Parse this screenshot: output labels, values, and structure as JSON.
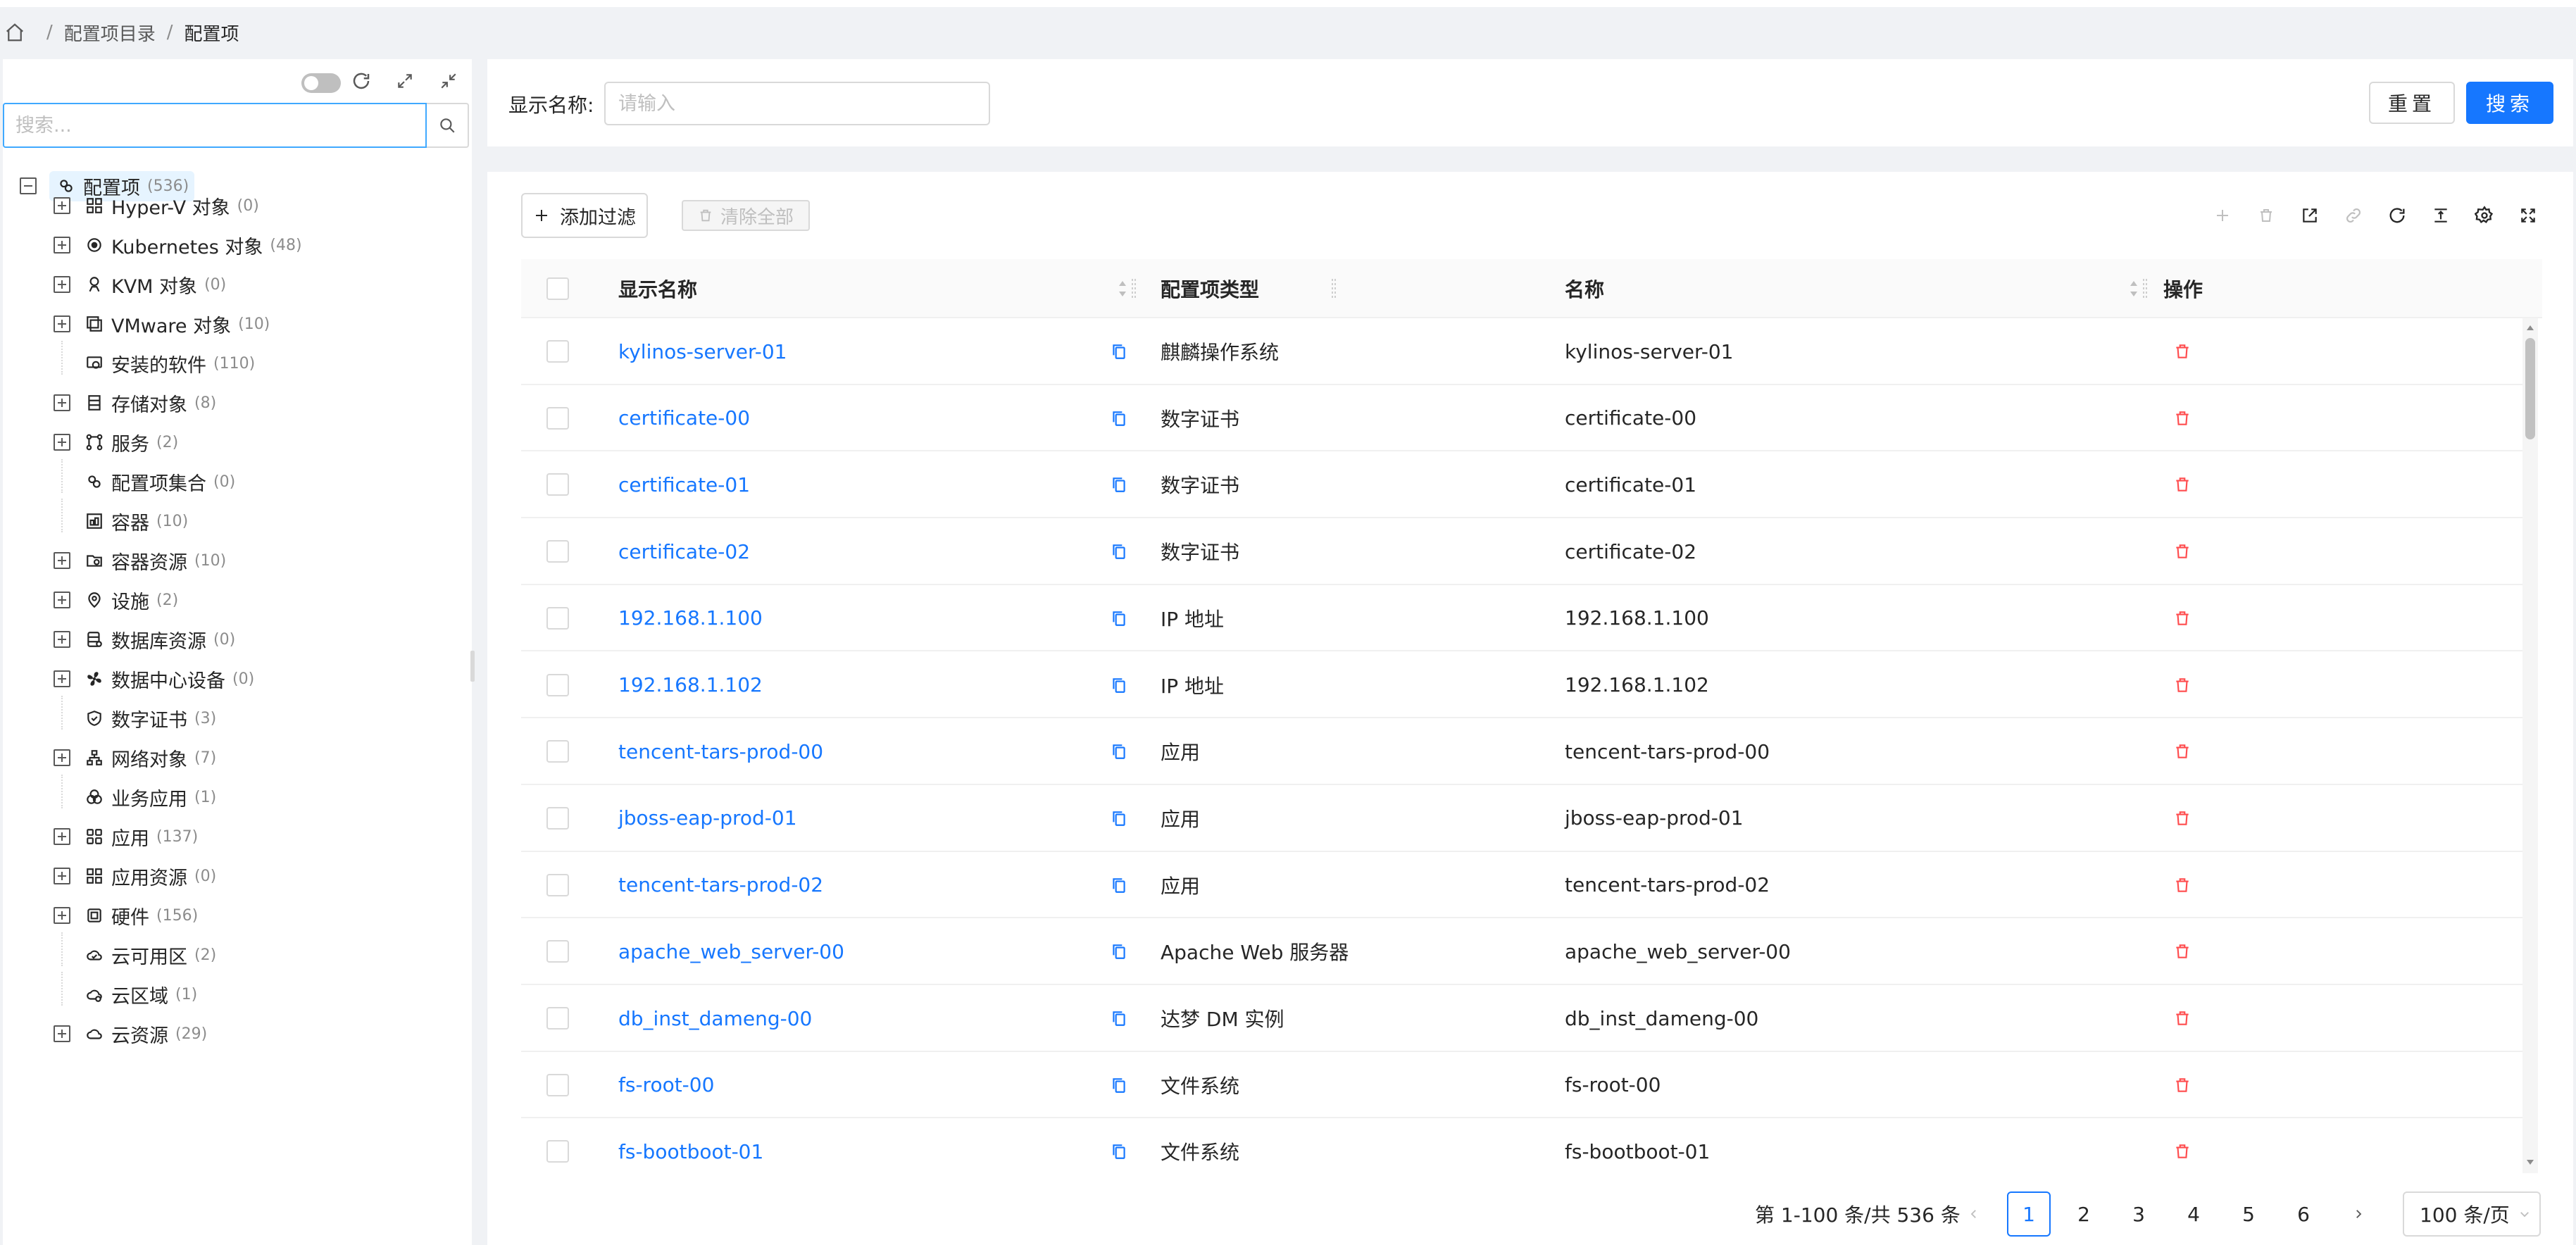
{
  "breadcrumb": {
    "items": [
      "配置项目录",
      "配置项"
    ],
    "separator": "/"
  },
  "tree": {
    "search_placeholder": "搜索...",
    "root": {
      "label": "配置项",
      "count": "(536)"
    },
    "nodes": [
      {
        "label": "Hyper-V 对象",
        "count": "(0)",
        "expandable": true,
        "icon": "hyperv-icon"
      },
      {
        "label": "Kubernetes 对象",
        "count": "(48)",
        "expandable": true,
        "icon": "kubernetes-icon"
      },
      {
        "label": "KVM 对象",
        "count": "(0)",
        "expandable": true,
        "icon": "kvm-icon"
      },
      {
        "label": "VMware 对象",
        "count": "(10)",
        "expandable": true,
        "icon": "vmware-icon"
      },
      {
        "label": "安装的软件",
        "count": "(110)",
        "expandable": false,
        "icon": "installed-software-icon"
      },
      {
        "label": "存储对象",
        "count": "(8)",
        "expandable": true,
        "icon": "storage-icon"
      },
      {
        "label": "服务",
        "count": "(2)",
        "expandable": true,
        "icon": "service-icon"
      },
      {
        "label": "配置项集合",
        "count": "(0)",
        "expandable": false,
        "icon": "ci-collection-icon"
      },
      {
        "label": "容器",
        "count": "(10)",
        "expandable": false,
        "icon": "container-icon"
      },
      {
        "label": "容器资源",
        "count": "(10)",
        "expandable": true,
        "icon": "container-resource-icon"
      },
      {
        "label": "设施",
        "count": "(2)",
        "expandable": true,
        "icon": "location-icon"
      },
      {
        "label": "数据库资源",
        "count": "(0)",
        "expandable": true,
        "icon": "database-icon"
      },
      {
        "label": "数据中心设备",
        "count": "(0)",
        "expandable": true,
        "icon": "fan-icon"
      },
      {
        "label": "数字证书",
        "count": "(3)",
        "expandable": false,
        "icon": "shield-icon"
      },
      {
        "label": "网络对象",
        "count": "(7)",
        "expandable": true,
        "icon": "network-icon"
      },
      {
        "label": "业务应用",
        "count": "(1)",
        "expandable": false,
        "icon": "business-app-icon"
      },
      {
        "label": "应用",
        "count": "(137)",
        "expandable": true,
        "icon": "app-icon"
      },
      {
        "label": "应用资源",
        "count": "(0)",
        "expandable": true,
        "icon": "app-resource-icon"
      },
      {
        "label": "硬件",
        "count": "(156)",
        "expandable": true,
        "icon": "chip-icon"
      },
      {
        "label": "云可用区",
        "count": "(2)",
        "expandable": false,
        "icon": "cloud-zone-icon"
      },
      {
        "label": "云区域",
        "count": "(1)",
        "expandable": false,
        "icon": "cloud-region-icon"
      },
      {
        "label": "云资源",
        "count": "(29)",
        "expandable": true,
        "icon": "cloud-icon"
      }
    ]
  },
  "filter": {
    "label": "显示名称:",
    "placeholder": "请输入",
    "reset_label": "重置",
    "search_label": "搜索"
  },
  "toolbar": {
    "add_filter_label": "添加过滤",
    "clear_all_label": "清除全部"
  },
  "table": {
    "columns": [
      "显示名称",
      "配置项类型",
      "名称",
      "操作"
    ],
    "rows": [
      {
        "display_name": "kylinos-server-01",
        "type": "麒麟操作系统",
        "name": "kylinos-server-01"
      },
      {
        "display_name": "certificate-00",
        "type": "数字证书",
        "name": "certificate-00"
      },
      {
        "display_name": "certificate-01",
        "type": "数字证书",
        "name": "certificate-01"
      },
      {
        "display_name": "certificate-02",
        "type": "数字证书",
        "name": "certificate-02"
      },
      {
        "display_name": "192.168.1.100",
        "type": "IP 地址",
        "name": "192.168.1.100"
      },
      {
        "display_name": "192.168.1.102",
        "type": "IP 地址",
        "name": "192.168.1.102"
      },
      {
        "display_name": "tencent-tars-prod-00",
        "type": "应用",
        "name": "tencent-tars-prod-00"
      },
      {
        "display_name": "jboss-eap-prod-01",
        "type": "应用",
        "name": "jboss-eap-prod-01"
      },
      {
        "display_name": "tencent-tars-prod-02",
        "type": "应用",
        "name": "tencent-tars-prod-02"
      },
      {
        "display_name": "apache_web_server-00",
        "type": "Apache Web 服务器",
        "name": "apache_web_server-00"
      },
      {
        "display_name": "db_inst_dameng-00",
        "type": "达梦 DM 实例",
        "name": "db_inst_dameng-00"
      },
      {
        "display_name": "fs-root-00",
        "type": "文件系统",
        "name": "fs-root-00"
      },
      {
        "display_name": "fs-bootboot-01",
        "type": "文件系统",
        "name": "fs-bootboot-01"
      }
    ]
  },
  "pagination": {
    "total_text": "第 1-100 条/共 536 条",
    "pages": [
      "1",
      "2",
      "3",
      "4",
      "5",
      "6"
    ],
    "current": "1",
    "page_size": "100 条/页"
  },
  "colors": {
    "primary": "#1677ff",
    "danger": "#ff4d4f",
    "background": "#f0f2f5"
  }
}
